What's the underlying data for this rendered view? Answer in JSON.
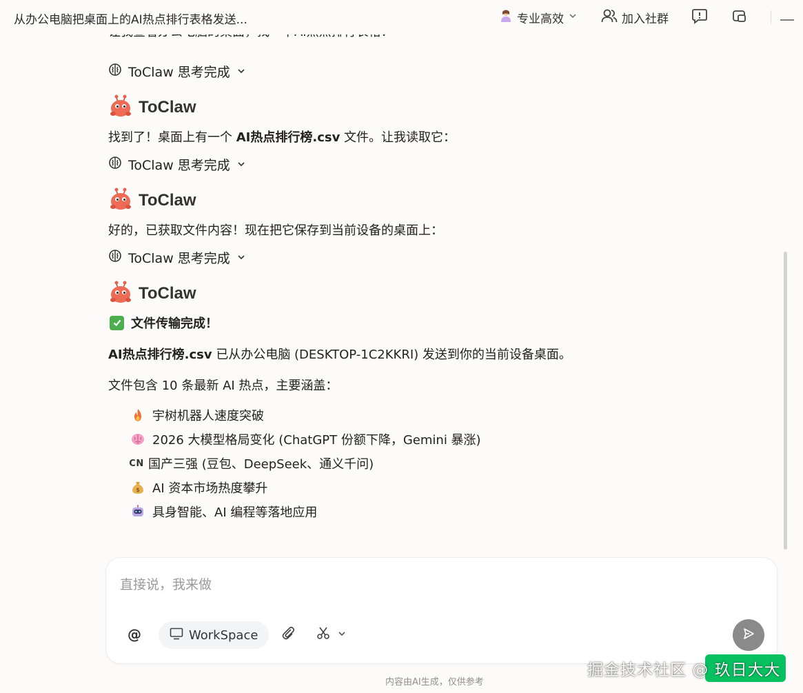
{
  "header": {
    "title": "从办公电脑把桌面上的AI热点排行表格发送...",
    "mode_label": "专业高效",
    "community_label": "加入社群"
  },
  "chat": {
    "cut_line": "让我查看办公电脑的桌面，找一下AI热点排行表格：",
    "thinking_label": "ToClaw 思考完成",
    "agent_name": "ToClaw",
    "msg1": {
      "pre": "找到了！桌面上有一个 ",
      "bold": "AI热点排行榜.csv",
      "post": " 文件。让我读取它："
    },
    "msg2": "好的，已获取文件内容！现在把它保存到当前设备的桌面上：",
    "done_title": "文件传输完成！",
    "msg3": {
      "bold": "AI热点排行榜.csv",
      "post": " 已从办公电脑 (DESKTOP-1C2KKRI) 发送到你的当前设备桌面。"
    },
    "summary_intro": "文件包含 10 条最新 AI 热点，主要涵盖：",
    "bullets": [
      {
        "icon": "fire-icon",
        "text": "宇树机器人速度突破"
      },
      {
        "icon": "brain-icon",
        "text": "2026 大模型格局变化 (ChatGPT 份额下降，Gemini 暴涨)"
      },
      {
        "icon": "cn-flag-icon",
        "glyph": "CN",
        "text": "国产三强 (豆包、DeepSeek、通义千问)"
      },
      {
        "icon": "money-bag-icon",
        "text": "AI 资本市场热度攀升"
      },
      {
        "icon": "robot-icon",
        "text": "具身智能、AI 编程等落地应用"
      }
    ]
  },
  "composer": {
    "placeholder": "直接说，我来做",
    "at_label": "@",
    "workspace_label": "WorkSpace"
  },
  "footer": {
    "disclaimer": "内容由AI生成，仅供参考"
  },
  "watermark": "掘金技术社区 @ 玖日大大",
  "colors": {
    "background": "#fcfbf9",
    "send_button": "#8a8a8a",
    "check_green": "#4cae4c",
    "tag_green": "#07c160"
  }
}
